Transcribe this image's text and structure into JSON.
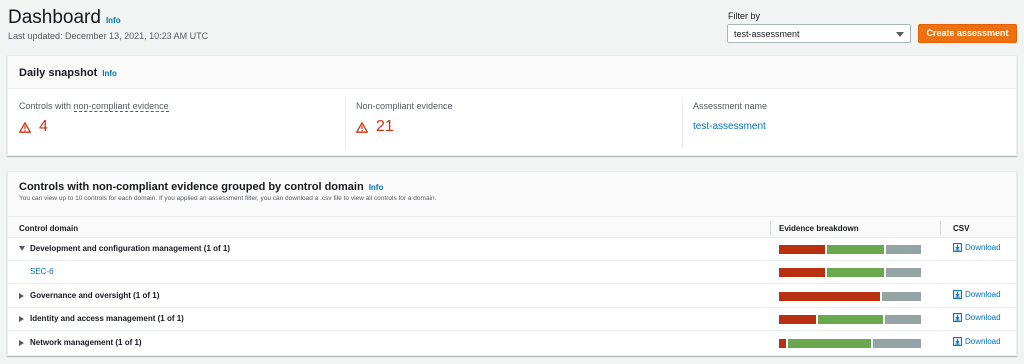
{
  "header": {
    "title": "Dashboard",
    "info": "Info",
    "last_updated": "Last updated: December 13, 2021, 10:23 AM UTC",
    "filter_label": "Filter by",
    "filter_value": "test-assessment",
    "create_button": "Create assessment"
  },
  "snapshot": {
    "title": "Daily snapshot",
    "info": "Info",
    "metrics": [
      {
        "label_prefix": "Controls with ",
        "label_underlined": "non-compliant evidence",
        "value": "4"
      },
      {
        "label": "Non-compliant evidence",
        "value": "21"
      },
      {
        "label": "Assessment name",
        "value": "test-assessment"
      }
    ]
  },
  "domains": {
    "title": "Controls with non-compliant evidence grouped by control domain",
    "info": "Info",
    "description": "You can view up to 10 controls for each domain. If you applied an assessment filter, you can download a .csv file to view all controls for a domain.",
    "columns": [
      "Control domain",
      "Evidence breakdown",
      "CSV"
    ],
    "download_label": "Download",
    "colors": {
      "noncompliant": "#b8300f",
      "compliant": "#6aa84f",
      "inconclusive": "#95a5a6"
    },
    "rows": [
      {
        "label": "Development and configuration management (1 of 1)",
        "expanded": true,
        "type": "group",
        "breakdown": {
          "noncompliant": 0.33,
          "compliant": 0.42,
          "inconclusive": 0.25
        },
        "download": true
      },
      {
        "label": "SEC-6",
        "type": "child",
        "breakdown": {
          "noncompliant": 0.33,
          "compliant": 0.42,
          "inconclusive": 0.25
        },
        "download": false
      },
      {
        "label": "Governance and oversight (1 of 1)",
        "expanded": false,
        "type": "group",
        "breakdown": {
          "noncompliant": 0.72,
          "compliant": 0.0,
          "inconclusive": 0.28
        },
        "download": true
      },
      {
        "label": "Identity and access management (1 of 1)",
        "expanded": false,
        "type": "group",
        "breakdown": {
          "noncompliant": 0.27,
          "compliant": 0.47,
          "inconclusive": 0.26
        },
        "download": true
      },
      {
        "label": "Network management (1 of 1)",
        "expanded": false,
        "type": "group",
        "breakdown": {
          "noncompliant": 0.05,
          "compliant": 0.6,
          "inconclusive": 0.35
        },
        "download": true
      }
    ]
  }
}
